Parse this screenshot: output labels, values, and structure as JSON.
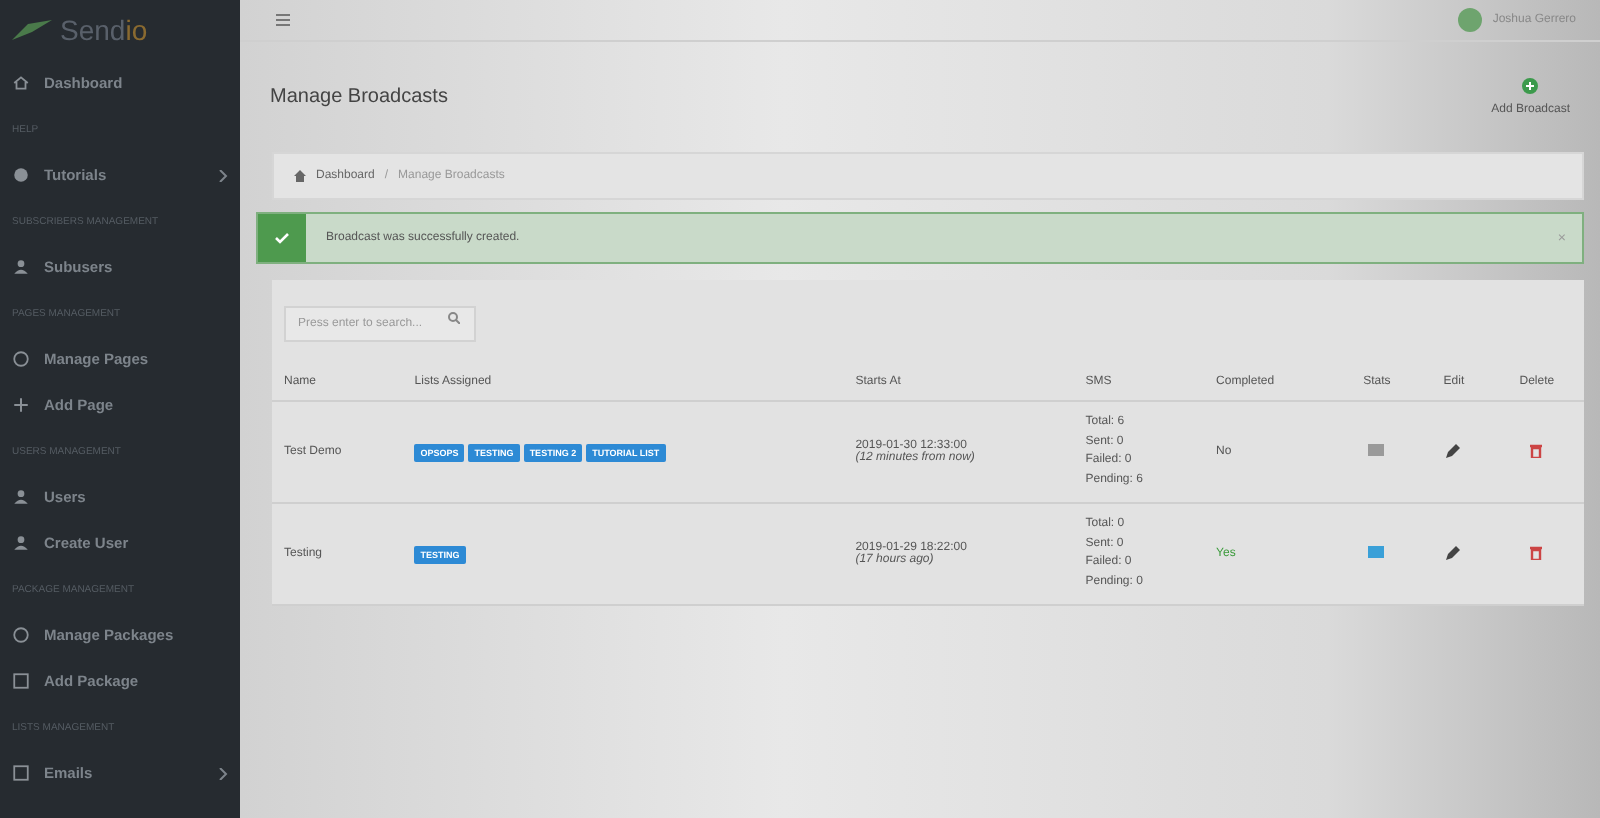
{
  "logo": {
    "text": "Send",
    "accent": "io"
  },
  "sidebar": [
    {
      "kind": "item",
      "label": "Dashboard",
      "has_children": false
    },
    {
      "kind": "heading",
      "label": "HELP"
    },
    {
      "kind": "item",
      "label": "Tutorials",
      "has_children": true
    },
    {
      "kind": "heading",
      "label": "SUBSCRIBERS MANAGEMENT"
    },
    {
      "kind": "item",
      "label": "Subusers",
      "has_children": false
    },
    {
      "kind": "heading",
      "label": "PAGES MANAGEMENT"
    },
    {
      "kind": "item",
      "label": "Manage Pages",
      "has_children": false
    },
    {
      "kind": "item",
      "label": "Add Page",
      "has_children": false
    },
    {
      "kind": "heading",
      "label": "USERS MANAGEMENT"
    },
    {
      "kind": "item",
      "label": "Users",
      "has_children": false
    },
    {
      "kind": "item",
      "label": "Create User",
      "has_children": false
    },
    {
      "kind": "heading",
      "label": "PACKAGE MANAGEMENT"
    },
    {
      "kind": "item",
      "label": "Manage Packages",
      "has_children": false
    },
    {
      "kind": "item",
      "label": "Add Package",
      "has_children": false
    },
    {
      "kind": "heading",
      "label": "LISTS MANAGEMENT"
    },
    {
      "kind": "item",
      "label": "Emails",
      "has_children": true
    }
  ],
  "topbar": {
    "user_name": "Joshua Gerrero"
  },
  "page_title": "Manage Broadcasts",
  "add_button": "Add Broadcast",
  "breadcrumb": [
    "Dashboard",
    "Manage Broadcasts"
  ],
  "breadcrumb_separator": "/",
  "alert": "Broadcast was successfully created.",
  "alert_close": "×",
  "search": {
    "placeholder": "Press enter to search..."
  },
  "table": {
    "columns": [
      "Name",
      "Lists Assigned",
      "Starts At",
      "SMS",
      "Completed",
      "Stats",
      "Edit",
      "Delete"
    ],
    "rows": [
      {
        "name": "Test Demo",
        "lists": [
          "OPSOPS",
          "TESTING",
          "TESTING 2",
          "TUTORIAL LIST"
        ],
        "starts": "2019-01-30 12:33:00",
        "relative": "(12 minutes from now)",
        "sms": [
          "Total: 6",
          "Sent: 0",
          "Failed: 0",
          "Pending: 6"
        ],
        "completed": {
          "text": "No",
          "done": false
        },
        "stats_available": false
      },
      {
        "name": "Testing",
        "lists": [
          "TESTING"
        ],
        "starts": "2019-01-29 18:22:00",
        "relative": "(17 hours ago)",
        "sms": [
          "Total: 0",
          "Sent: 0",
          "Failed: 0",
          "Pending: 0"
        ],
        "completed": {
          "text": "Yes",
          "done": true
        },
        "stats_available": true
      }
    ]
  }
}
